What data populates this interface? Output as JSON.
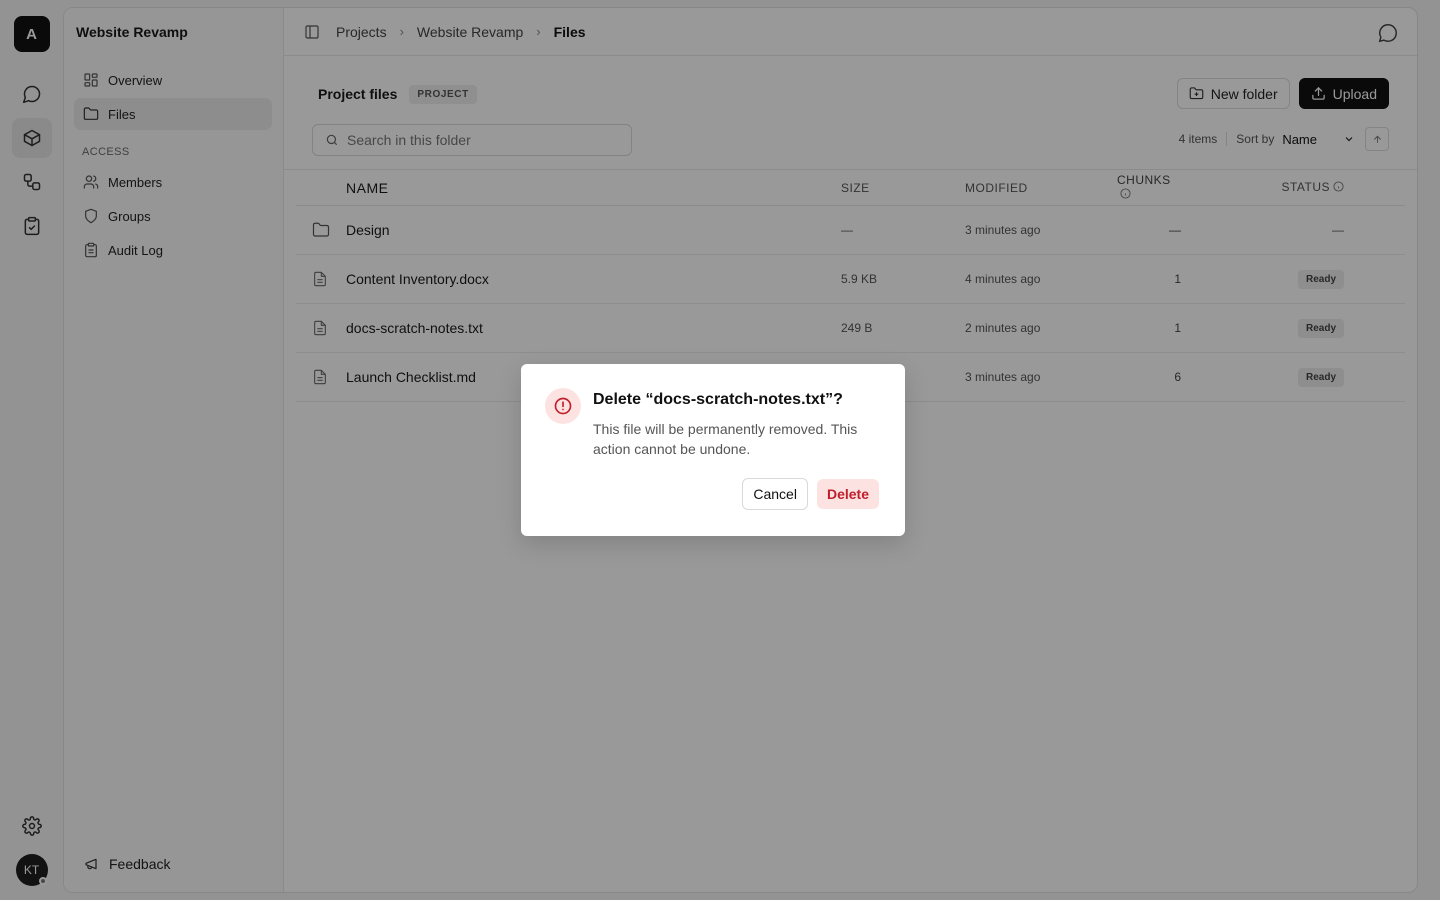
{
  "rail": {
    "logo_letter": "A",
    "items": [
      {
        "icon": "chat-bubble-icon"
      },
      {
        "icon": "cube-icon",
        "active": true
      },
      {
        "icon": "workflow-icon"
      },
      {
        "icon": "clipboard-check-icon"
      }
    ],
    "avatar_initials": "KT"
  },
  "sidebar": {
    "title": "Website Revamp",
    "items": [
      {
        "label": "Overview",
        "icon": "grid-icon"
      },
      {
        "label": "Files",
        "icon": "folder-icon",
        "active": true
      }
    ],
    "access_label": "ACCESS",
    "access_items": [
      {
        "label": "Members",
        "icon": "users-icon"
      },
      {
        "label": "Groups",
        "icon": "shield-icon"
      },
      {
        "label": "Audit Log",
        "icon": "clipboard-icon"
      }
    ],
    "feedback_label": "Feedback"
  },
  "breadcrumb": [
    "Projects",
    "Website Revamp",
    "Files"
  ],
  "header": {
    "title": "Project files",
    "badge": "PROJECT",
    "new_folder_label": "New folder",
    "upload_label": "Upload"
  },
  "search": {
    "placeholder": "Search in this folder"
  },
  "toolbar": {
    "item_count": "4 items",
    "sort_label": "Sort by",
    "sort_value": "Name"
  },
  "table": {
    "columns": {
      "name": "NAME",
      "size": "SIZE",
      "modified": "MODIFIED",
      "chunks": "CHUNKS",
      "status": "STATUS"
    },
    "rows": [
      {
        "type": "folder",
        "name": "Design",
        "size": "—",
        "modified": "3 minutes ago",
        "chunks": "—",
        "status": "—"
      },
      {
        "type": "file",
        "name": "Content Inventory.docx",
        "size": "5.9 KB",
        "modified": "4 minutes ago",
        "chunks": "1",
        "status": "Ready"
      },
      {
        "type": "file",
        "name": "docs-scratch-notes.txt",
        "size": "249 B",
        "modified": "2 minutes ago",
        "chunks": "1",
        "status": "Ready"
      },
      {
        "type": "file",
        "name": "Launch Checklist.md",
        "size": "",
        "modified": "3 minutes ago",
        "chunks": "6",
        "status": "Ready"
      }
    ]
  },
  "dialog": {
    "title": "Delete “docs-scratch-notes.txt”?",
    "body": "This file will be permanently removed. This action cannot be undone.",
    "cancel_label": "Cancel",
    "delete_label": "Delete"
  },
  "colors": {
    "danger": "#c0202c",
    "danger_bg": "#fde2e2",
    "primary": "#111111"
  }
}
